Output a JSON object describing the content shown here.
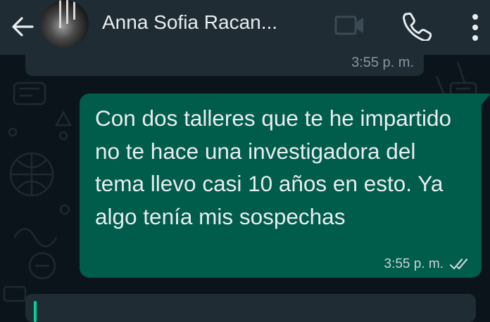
{
  "header": {
    "contact_name": "Anna Sofia Racan...",
    "back_icon": "arrow-left-icon",
    "video_icon": "video-camera-icon",
    "phone_icon": "phone-icon",
    "menu_icon": "more-vertical-icon"
  },
  "messages": {
    "previous": {
      "time": "3:55 p. m."
    },
    "outgoing": {
      "text": "Con dos talleres que te he impartido no te hace una investigadora del tema llevo casi 10 años en esto. Ya algo tenía mis sospechas",
      "time": "3:55 p. m.",
      "status_icon": "double-check-icon"
    }
  },
  "colors": {
    "background": "#0b141a",
    "header": "#1f2c34",
    "outgoing_bubble": "#005c4b",
    "incoming_bubble": "#1f2c34",
    "accent": "#06cf9c"
  }
}
